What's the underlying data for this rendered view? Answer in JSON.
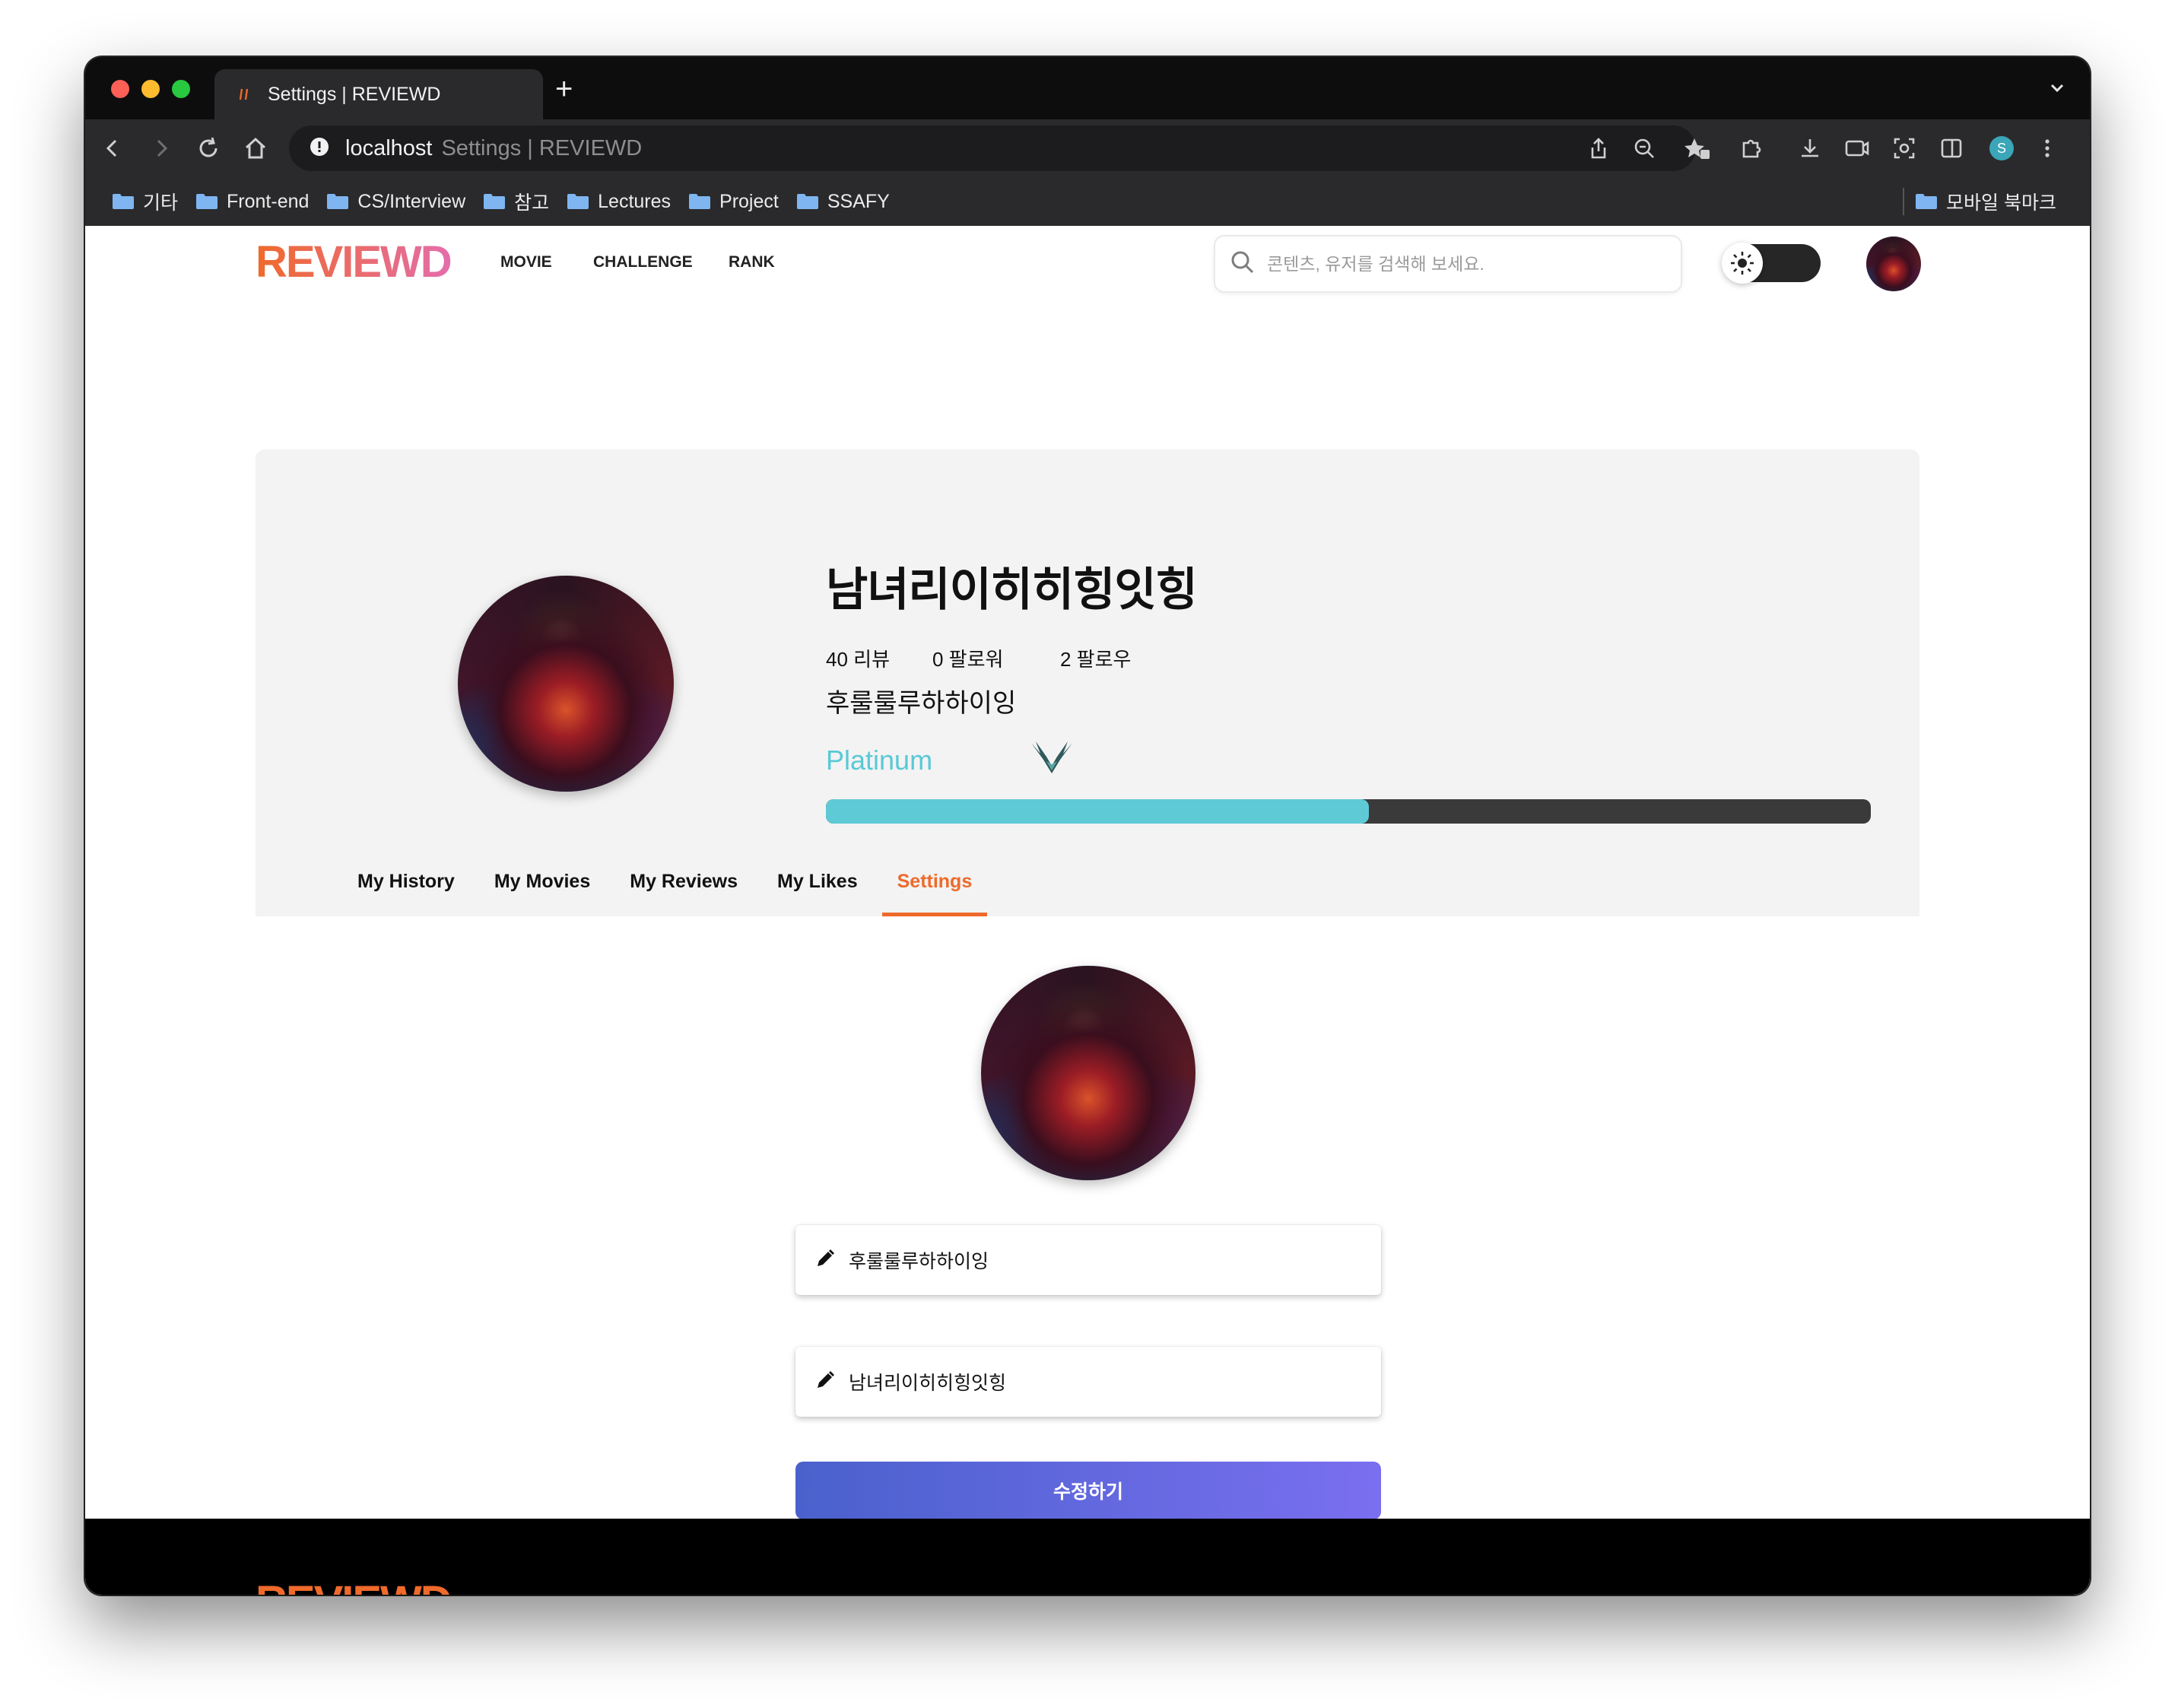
{
  "browser": {
    "tab_title": "Settings | REVIEWD",
    "new_tab_label": "+",
    "address_host": "localhost",
    "address_title": "Settings | REVIEWD",
    "profile_initial": "S",
    "bookmarks": [
      "기타",
      "Front-end",
      "CS/Interview",
      "참고",
      "Lectures",
      "Project",
      "SSAFY"
    ],
    "mobile_bookmarks": "모바일 북마크"
  },
  "site": {
    "logo": "REVIEWD",
    "nav": [
      "MOVIE",
      "CHALLENGE",
      "RANK"
    ],
    "search_placeholder": "콘텐츠, 유저를 검색해 보세요.",
    "theme_icon": "sun-icon"
  },
  "profile": {
    "name": "남녀리이히히힝잇힝",
    "stats": [
      {
        "label": "40 리뷰"
      },
      {
        "label": "0 팔로워"
      },
      {
        "label": "2 팔로우"
      }
    ],
    "nickname": "후룰룰루하하이잉",
    "tier": "Platinum",
    "tier_color": "#58c9d6",
    "progress_fraction": 0.52
  },
  "tabs": [
    {
      "label": "My History",
      "active": false
    },
    {
      "label": "My Movies",
      "active": false
    },
    {
      "label": "My Reviews",
      "active": false
    },
    {
      "label": "My Likes",
      "active": false
    },
    {
      "label": "Settings",
      "active": true
    }
  ],
  "settings_form": {
    "nickname_value": "후룰룰루하하이잉",
    "name_value": "남녀리이히히힝잇힝",
    "field_icon": "pencil-icon",
    "submit_label": "수정하기"
  },
  "footer": {
    "logo": "REVIEWD"
  },
  "colors": {
    "accent": "#ee6a2b",
    "button_gradient_start": "#4a61cc",
    "button_gradient_end": "#7a6ff0",
    "progress_track": "#3a3a3a"
  }
}
